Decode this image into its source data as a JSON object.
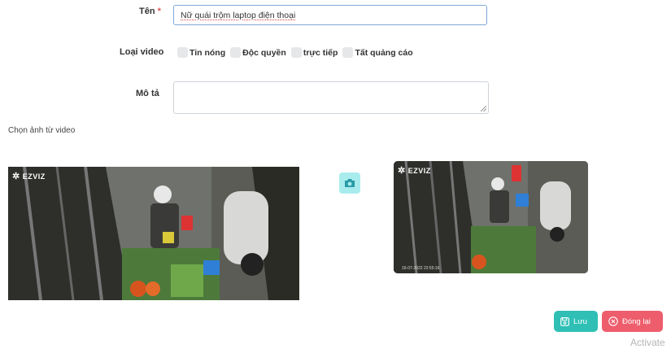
{
  "form": {
    "name_label": "Tên",
    "required_mark": "*",
    "name_value": "Nữ quái trộm laptop điện thoại",
    "video_type_label": "Loại video",
    "video_types": [
      "Tin nóng",
      "Độc quyền",
      "trực tiếp",
      "Tất quảng cáo"
    ],
    "description_label": "Mô tả",
    "description_value": ""
  },
  "thumbnail": {
    "section_title": "Chọn ảnh từ video",
    "watermark": "EZVIZ",
    "capture_icon": "camera-icon",
    "timestamp": "16-07-2022 22:55:16"
  },
  "actions": {
    "save_label": "Lưu",
    "close_label": "Đóng lại",
    "save_icon": "save-icon",
    "close_icon": "close-circle-icon"
  },
  "watermark_text": "Activate",
  "colors": {
    "save": "#2fbfb5",
    "close": "#ee5d6c",
    "camera_btn": "#a9ecee"
  }
}
